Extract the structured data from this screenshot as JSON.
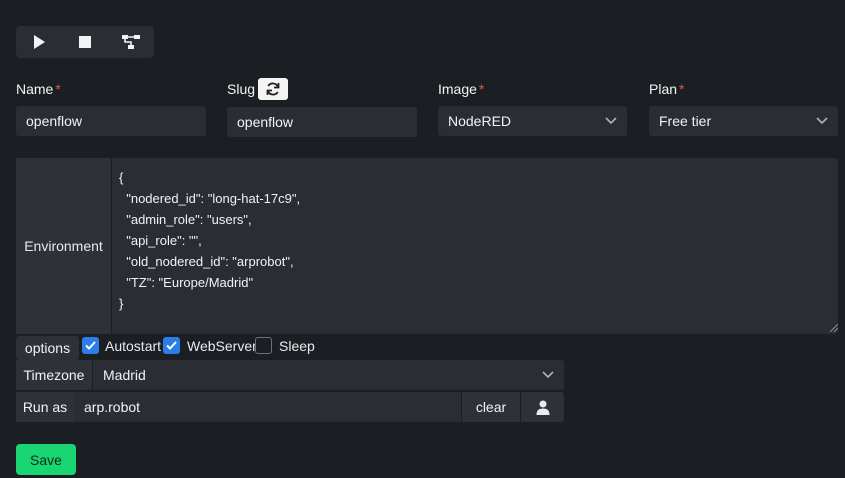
{
  "toolbar": {
    "buttons": [
      "play-icon",
      "stop-icon",
      "workflow-icon"
    ]
  },
  "name": {
    "label": "Name",
    "required": "*",
    "value": "openflow"
  },
  "slug": {
    "label": "Slug",
    "value": "openflow"
  },
  "image": {
    "label": "Image",
    "required": "*",
    "value": "NodeRED"
  },
  "plan": {
    "label": "Plan",
    "required": "*",
    "value": "Free tier"
  },
  "environment": {
    "label": "Environment",
    "text": "{\n  \"nodered_id\": \"long-hat-17c9\",\n  \"admin_role\": \"users\",\n  \"api_role\": \"\",\n  \"old_nodered_id\": \"arprobot\",\n  \"TZ\": \"Europe/Madrid\"\n}"
  },
  "options": {
    "label": "options",
    "autostart": {
      "label": "Autostart",
      "checked": true
    },
    "webserver": {
      "label": "WebServer",
      "checked": true
    },
    "sleep": {
      "label": "Sleep",
      "checked": false
    }
  },
  "timezone": {
    "label": "Timezone",
    "value": "Madrid"
  },
  "runas": {
    "label": "Run as",
    "value": "arp.robot",
    "clear": "clear"
  },
  "save": "Save",
  "colors": {
    "accent": "#2b7de9",
    "save": "#19d672",
    "required": "#e5534b",
    "background": "#1b1f24",
    "field": "#2a2e34"
  }
}
